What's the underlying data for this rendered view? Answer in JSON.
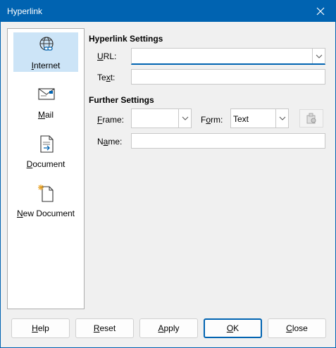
{
  "window": {
    "title": "Hyperlink"
  },
  "sidebar": {
    "items": [
      {
        "u": "I",
        "rest": "nternet",
        "icon": "globe-link-icon"
      },
      {
        "u": "M",
        "rest": "ail",
        "icon": "envelope-icon"
      },
      {
        "u": "D",
        "rest": "ocument",
        "icon": "document-icon"
      },
      {
        "u": "N",
        "rest": "ew Document",
        "icon": "new-document-icon"
      }
    ],
    "selected": "Internet"
  },
  "hyperlink_settings": {
    "heading": "Hyperlink Settings",
    "url_label": {
      "u": "U",
      "rest": "RL:"
    },
    "url_value": "",
    "text_label": {
      "pre": "Te",
      "u": "x",
      "rest": "t:"
    },
    "text_value": ""
  },
  "further_settings": {
    "heading": "Further Settings",
    "frame_label": {
      "u": "F",
      "rest": "rame:"
    },
    "frame_value": "",
    "form_label": {
      "pre": "F",
      "u": "o",
      "rest": "rm:"
    },
    "form_value": "Text",
    "events_icon": "macro-events-icon",
    "name_label": {
      "pre": "N",
      "u": "a",
      "rest": "me:"
    },
    "name_value": ""
  },
  "buttons": {
    "help": {
      "u": "H",
      "rest": "elp"
    },
    "reset": {
      "u": "R",
      "rest": "eset"
    },
    "apply": {
      "u": "A",
      "rest": "pply"
    },
    "ok": {
      "u": "O",
      "rest": "K"
    },
    "close": {
      "u": "C",
      "rest": "lose"
    }
  },
  "colors": {
    "accent": "#0063b1",
    "selection": "#cce4f7"
  }
}
